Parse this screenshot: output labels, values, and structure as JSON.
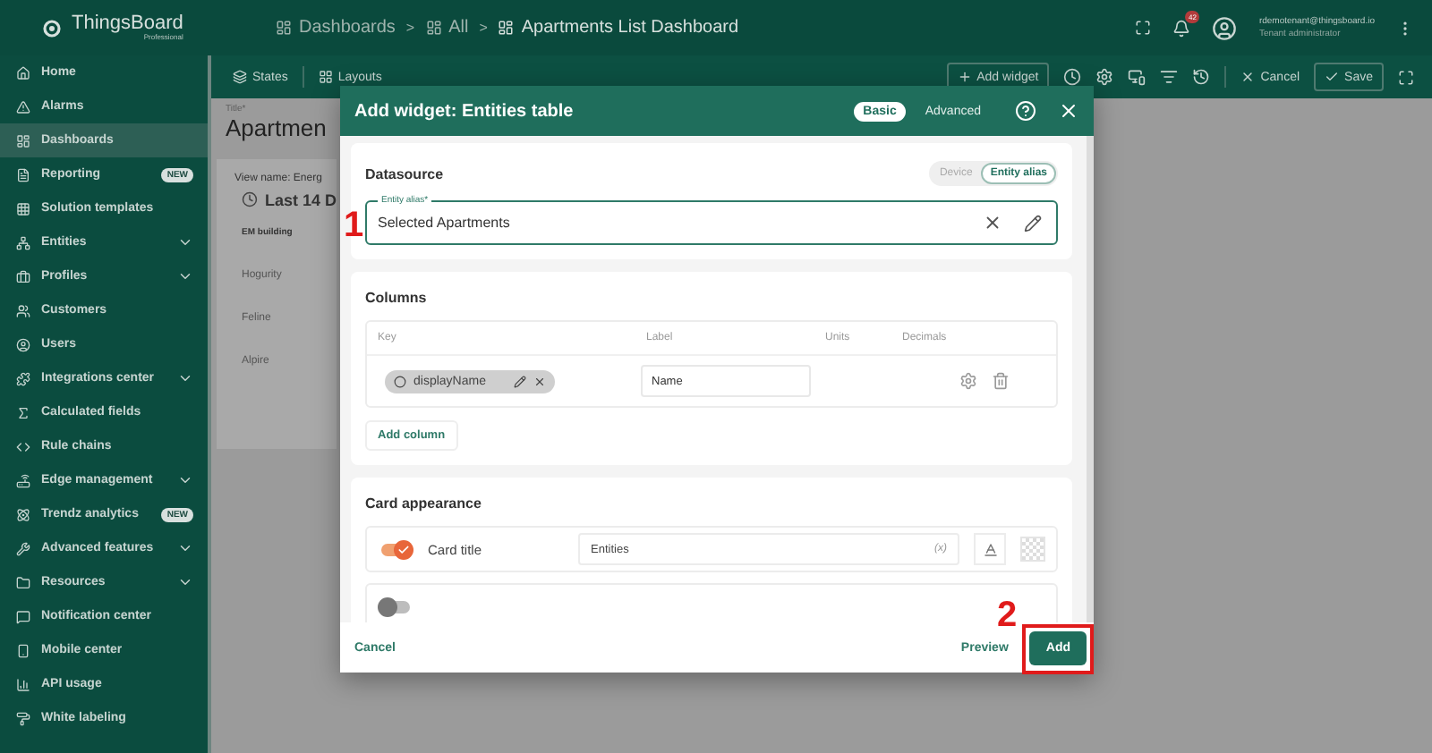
{
  "header": {
    "logo": {
      "name": "ThingsBoard",
      "edition": "Professional"
    },
    "breadcrumbs": [
      "Dashboards",
      "All",
      "Apartments List Dashboard"
    ],
    "separators": [
      ">",
      ">"
    ],
    "notification_count": "42",
    "user": {
      "email": "rdemotenant@thingsboard.io",
      "role": "Tenant administrator"
    }
  },
  "sidebar": {
    "items": [
      {
        "label": "Home",
        "selected": false,
        "expandable": false
      },
      {
        "label": "Alarms",
        "selected": false,
        "expandable": false
      },
      {
        "label": "Dashboards",
        "selected": true,
        "expandable": false
      },
      {
        "label": "Reporting",
        "selected": false,
        "expandable": false,
        "badge": "NEW"
      },
      {
        "label": "Solution templates",
        "selected": false,
        "expandable": false
      },
      {
        "label": "Entities",
        "selected": false,
        "expandable": true
      },
      {
        "label": "Profiles",
        "selected": false,
        "expandable": true
      },
      {
        "label": "Customers",
        "selected": false,
        "expandable": false
      },
      {
        "label": "Users",
        "selected": false,
        "expandable": false
      },
      {
        "label": "Integrations center",
        "selected": false,
        "expandable": true
      },
      {
        "label": "Calculated fields",
        "selected": false,
        "expandable": false
      },
      {
        "label": "Rule chains",
        "selected": false,
        "expandable": false
      },
      {
        "label": "Edge management",
        "selected": false,
        "expandable": true
      },
      {
        "label": "Trendz analytics",
        "selected": false,
        "expandable": false,
        "badge": "NEW"
      },
      {
        "label": "Advanced features",
        "selected": false,
        "expandable": true
      },
      {
        "label": "Resources",
        "selected": false,
        "expandable": true
      },
      {
        "label": "Notification center",
        "selected": false,
        "expandable": false
      },
      {
        "label": "Mobile center",
        "selected": false,
        "expandable": false
      },
      {
        "label": "API usage",
        "selected": false,
        "expandable": false
      },
      {
        "label": "White labeling",
        "selected": false,
        "expandable": false
      }
    ]
  },
  "toolbar": {
    "states": "States",
    "layouts": "Layouts",
    "add_widget": "Add widget",
    "cancel": "Cancel",
    "save": "Save"
  },
  "dashboard": {
    "title_label": "Title*",
    "title": "Apartmen",
    "view_name": "View name: Energ",
    "time_window": "Last 14 D",
    "column_header": "EM building",
    "rows": [
      "Hogurity",
      "Feline",
      "Alpire"
    ]
  },
  "dialog": {
    "title": "Add widget: Entities table",
    "modes": [
      {
        "label": "Basic",
        "selected": true
      },
      {
        "label": "Advanced",
        "selected": false
      }
    ],
    "datasource": {
      "title": "Datasource",
      "types": [
        {
          "label": "Device",
          "selected": false
        },
        {
          "label": "Entity alias",
          "selected": true
        }
      ],
      "field": {
        "label": "Entity alias*",
        "value": "Selected Apartments"
      }
    },
    "columns": {
      "title": "Columns",
      "headers": [
        "Key",
        "Label",
        "Units",
        "Decimals"
      ],
      "rows": [
        {
          "key": "displayName",
          "label": "Name"
        }
      ],
      "add_button": "Add column"
    },
    "card_appearance": {
      "title": "Card appearance",
      "rows": [
        {
          "on": true,
          "label": "Card title",
          "value": "Entities",
          "suffix": "(x)"
        },
        {
          "on": false
        }
      ]
    },
    "footer": {
      "cancel": "Cancel",
      "preview": "Preview",
      "add": "Add"
    }
  },
  "annotations": [
    {
      "label": "1"
    },
    {
      "label": "2"
    }
  ]
}
